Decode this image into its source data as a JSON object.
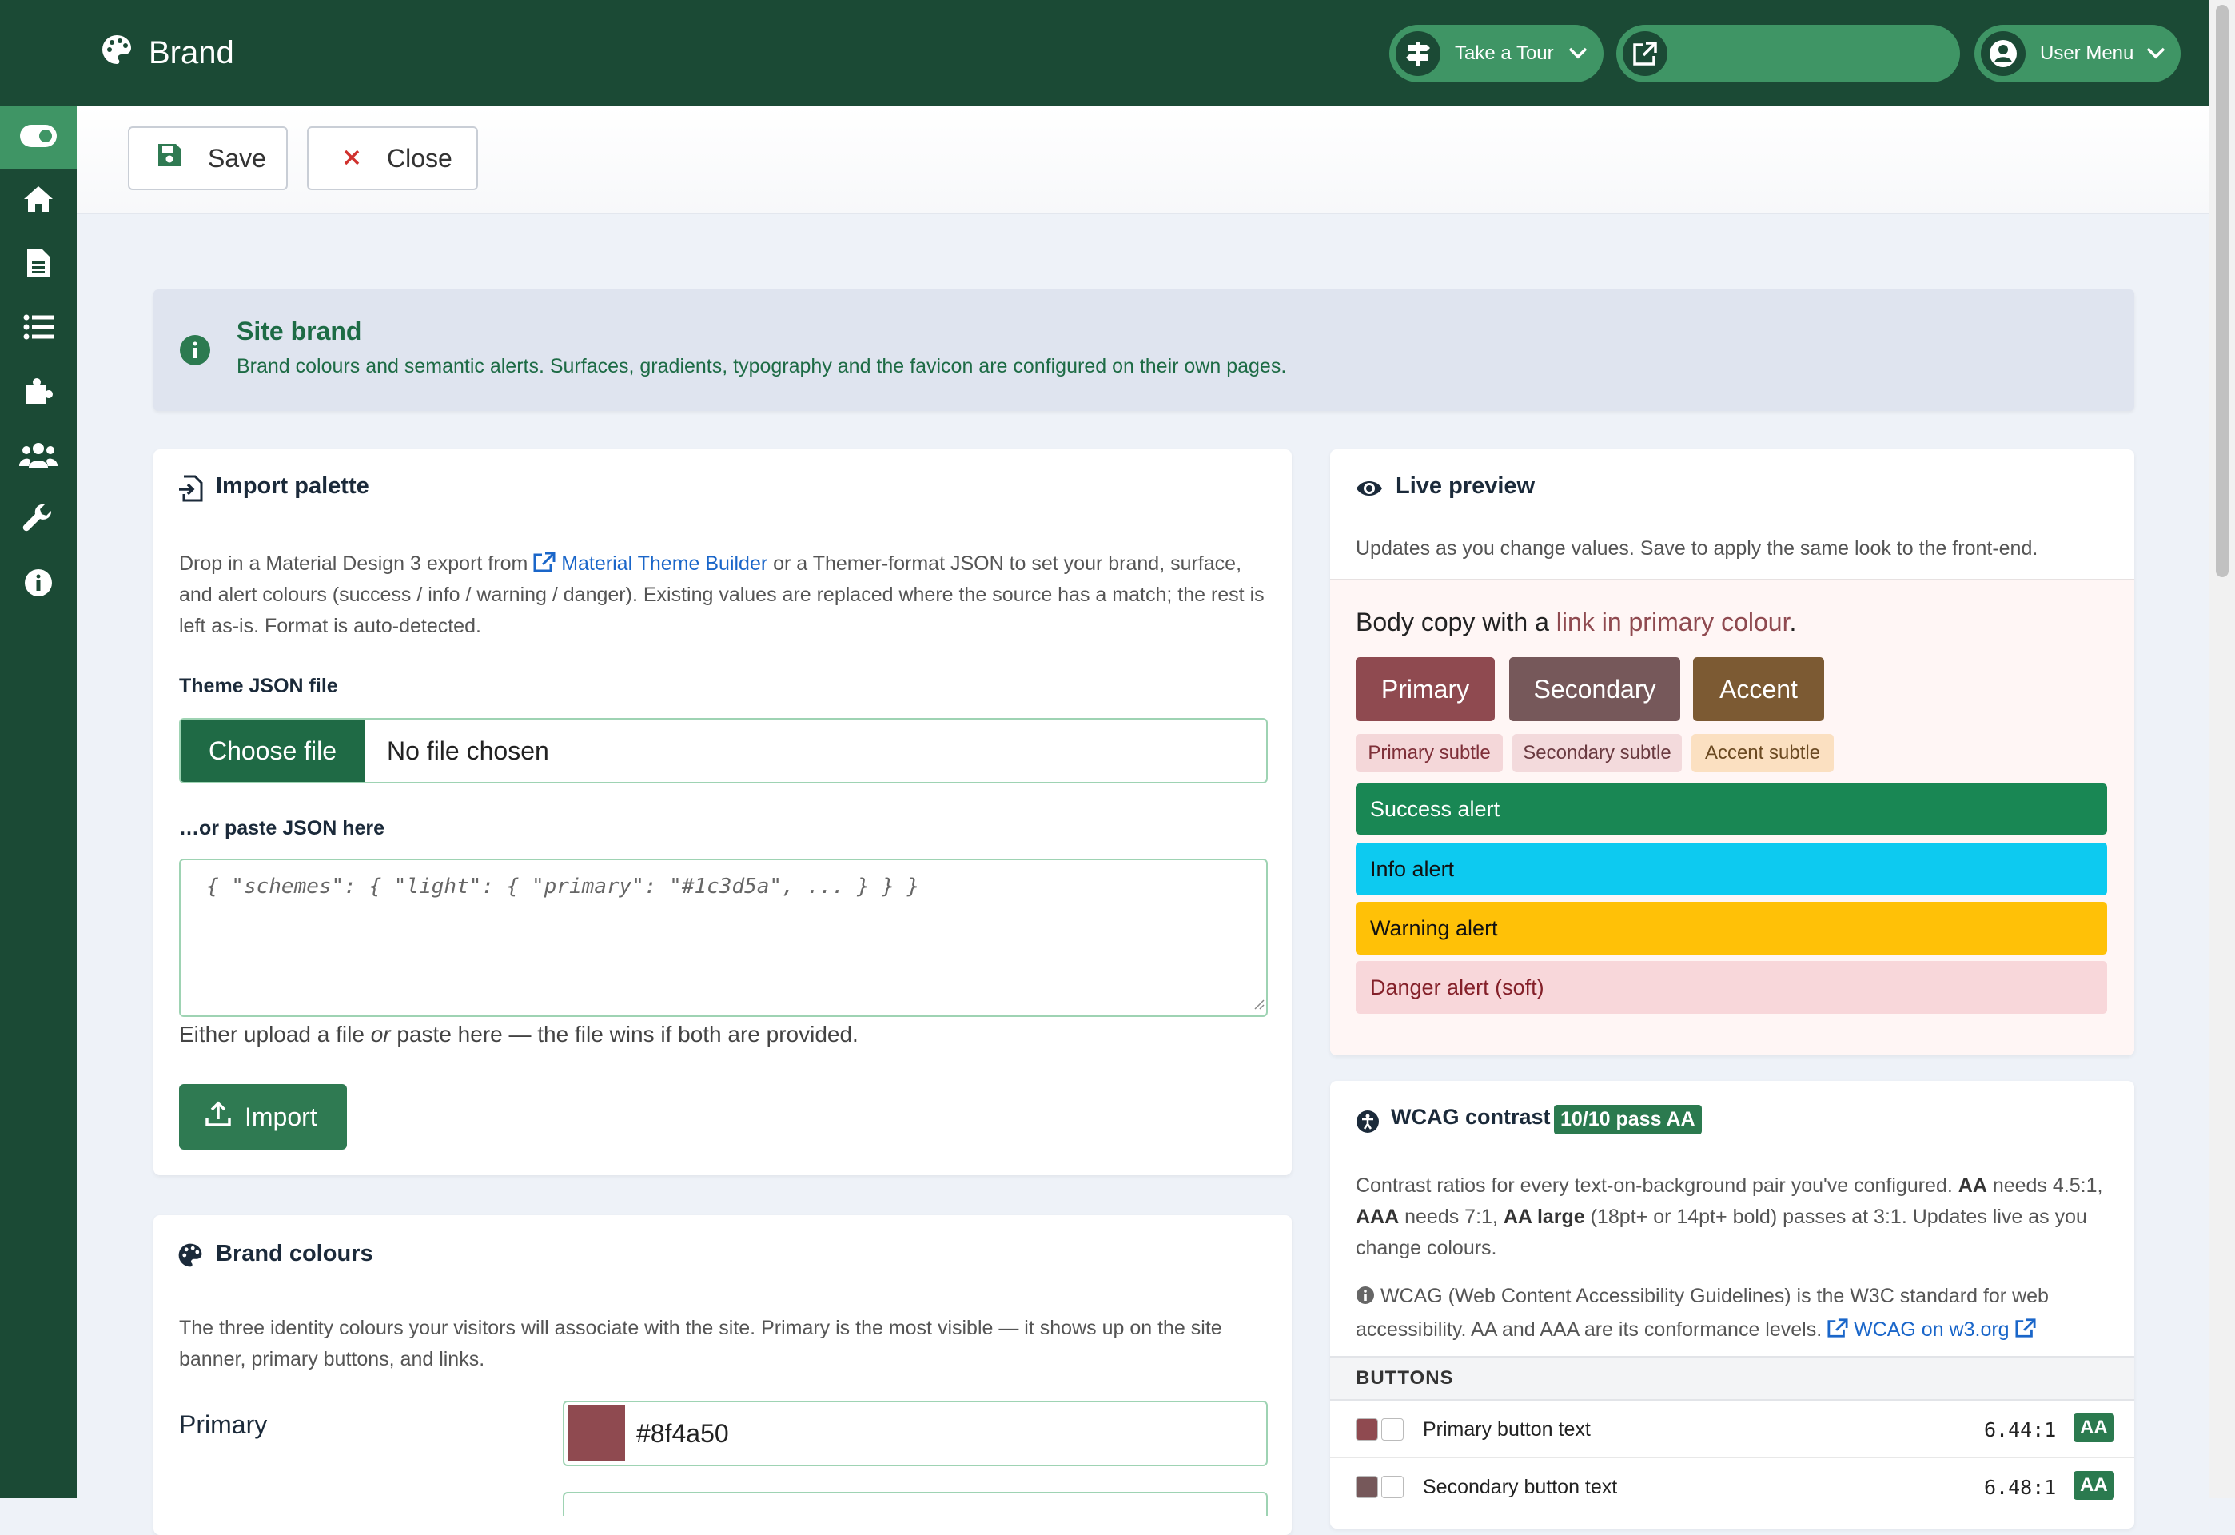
{
  "app": {
    "title": "Brand"
  },
  "header": {
    "tour_label": "Take a Tour",
    "user_menu_label": "User Menu"
  },
  "toolbar": {
    "save_label": "Save",
    "close_label": "Close"
  },
  "sidebar": {
    "items": [
      {
        "icon": "home-icon"
      },
      {
        "icon": "file-icon"
      },
      {
        "icon": "list-icon"
      },
      {
        "icon": "puzzle-icon"
      },
      {
        "icon": "users-icon"
      },
      {
        "icon": "wrench-icon"
      },
      {
        "icon": "info-icon"
      }
    ]
  },
  "site_brand": {
    "title": "Site brand",
    "description": "Brand colours and semantic alerts. Surfaces, gradients, typography and the favicon are configured on their own pages."
  },
  "import_palette": {
    "title": "Import palette",
    "desc_before": "Drop in a Material Design 3 export from ",
    "link_text": "Material Theme Builder",
    "desc_after": " or a Themer-format JSON to set your brand, surface, and alert colours (success / info / warning / danger). Existing values are replaced where the source has a match; the rest is left as-is. Format is auto-detected.",
    "file_label": "Theme JSON file",
    "choose_file": "Choose file",
    "no_file": "No file chosen",
    "paste_label": "…or paste JSON here",
    "paste_placeholder": "{ \"schemes\": { \"light\": { \"primary\": \"#1c3d5a\", ... } } }",
    "hint_before": "Either upload a file ",
    "hint_or": "or",
    "hint_after": " paste here — the file wins if both are provided.",
    "import_button": "Import"
  },
  "brand_colours": {
    "title": "Brand colours",
    "description": "The three identity colours your visitors will associate with the site. Primary is the most visible — it shows up on the site banner, primary buttons, and links.",
    "primary_label": "Primary",
    "primary_value": "#8f4a50"
  },
  "live_preview": {
    "title": "Live preview",
    "subtitle": "Updates as you change values. Save to apply the same look to the front-end.",
    "body_before": "Body copy with a ",
    "body_link": "link in primary colour",
    "body_after": ".",
    "buttons": [
      "Primary",
      "Secondary",
      "Accent"
    ],
    "subtle": [
      "Primary subtle",
      "Secondary subtle",
      "Accent subtle"
    ],
    "alerts": [
      "Success alert",
      "Info alert",
      "Warning alert",
      "Danger alert (soft)"
    ],
    "colors": {
      "primary": "#8f4a50",
      "secondary": "#76585a",
      "accent": "#7c5a33",
      "success": "#198754",
      "info": "#0dcaf0",
      "warning": "#ffc107",
      "danger_soft": "#f8d7da"
    }
  },
  "wcag": {
    "title": "WCAG contrast",
    "badge": "10/10 pass AA",
    "p1_a": "Contrast ratios for every text-on-background pair you've configured. ",
    "aa": "AA",
    "p1_b": " needs 4.5:1, ",
    "aaa": "AAA",
    "p1_c": " needs 7:1, ",
    "aa_large": "AA large",
    "p1_d": " (18pt+ or 14pt+ bold) passes at 3:1. Updates live as you change colours.",
    "p2": "WCAG (Web Content Accessibility Guidelines) is the W3C standard for web accessibility. AA and AAA are its conformance levels.",
    "p2_link": "WCAG on w3.org",
    "section": "BUTTONS",
    "rows": [
      {
        "label": "Primary button text",
        "ratio": "6.44:1",
        "grade": "AA"
      },
      {
        "label": "Secondary button text",
        "ratio": "6.48:1",
        "grade": "AA"
      }
    ]
  }
}
